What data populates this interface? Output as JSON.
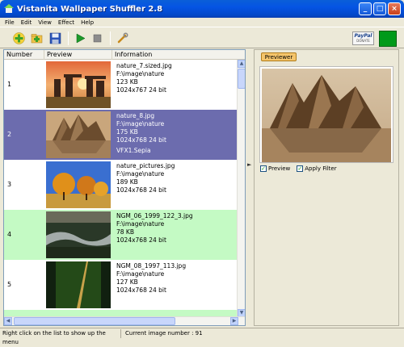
{
  "window": {
    "title": "Vistanita Wallpaper Shuffler 2.8",
    "controls": [
      "_",
      "□",
      "×"
    ]
  },
  "menu": [
    "File",
    "Edit",
    "View",
    "Effect",
    "Help"
  ],
  "toolbar": {
    "icons": [
      "add-icon",
      "add-folder-icon",
      "save-icon",
      "play-icon",
      "stop-icon",
      "settings-wrench-icon"
    ],
    "paypal_label": "PayPal",
    "paypal_sub": "DONATE"
  },
  "list": {
    "columns": [
      "Number",
      "Preview",
      "Information"
    ],
    "rows": [
      {
        "number": "1",
        "name": "nature_7.sized.jpg",
        "path": "F:\\image\\nature",
        "size": "123 KB",
        "dims": "1024x767 24 bit",
        "effect": "",
        "state": "normal"
      },
      {
        "number": "2",
        "name": "nature_8.jpg",
        "path": "F:\\image\\nature",
        "size": "175 KB",
        "dims": "1024x768 24 bit",
        "effect": "VFX1.Sepia",
        "state": "selected"
      },
      {
        "number": "3",
        "name": "nature_pictures.jpg",
        "path": "F:\\image\\nature",
        "size": "189 KB",
        "dims": "1024x768 24 bit",
        "effect": "",
        "state": "normal"
      },
      {
        "number": "4",
        "name": "NGM_06_1999_122_3.jpg",
        "path": "F:\\image\\nature",
        "size": "78 KB",
        "dims": "1024x768 24 bit",
        "effect": "",
        "state": "current"
      },
      {
        "number": "5",
        "name": "NGM_08_1997_113.jpg",
        "path": "F:\\image\\nature",
        "size": "127 KB",
        "dims": "1024x768 24 bit",
        "effect": "",
        "state": "normal"
      }
    ]
  },
  "preview": {
    "tab_label": "Previewer",
    "preview_checkbox": {
      "label": "Preview",
      "checked": true
    },
    "filter_checkbox": {
      "label": "Apply Filter",
      "checked": true
    }
  },
  "status": {
    "hint": "Right click on the list to show up the menu",
    "current": "Current image number : 91"
  },
  "colors": {
    "selected_row": "#6c6cae",
    "current_row": "#c4fac4",
    "accent_green": "#009a1a"
  }
}
